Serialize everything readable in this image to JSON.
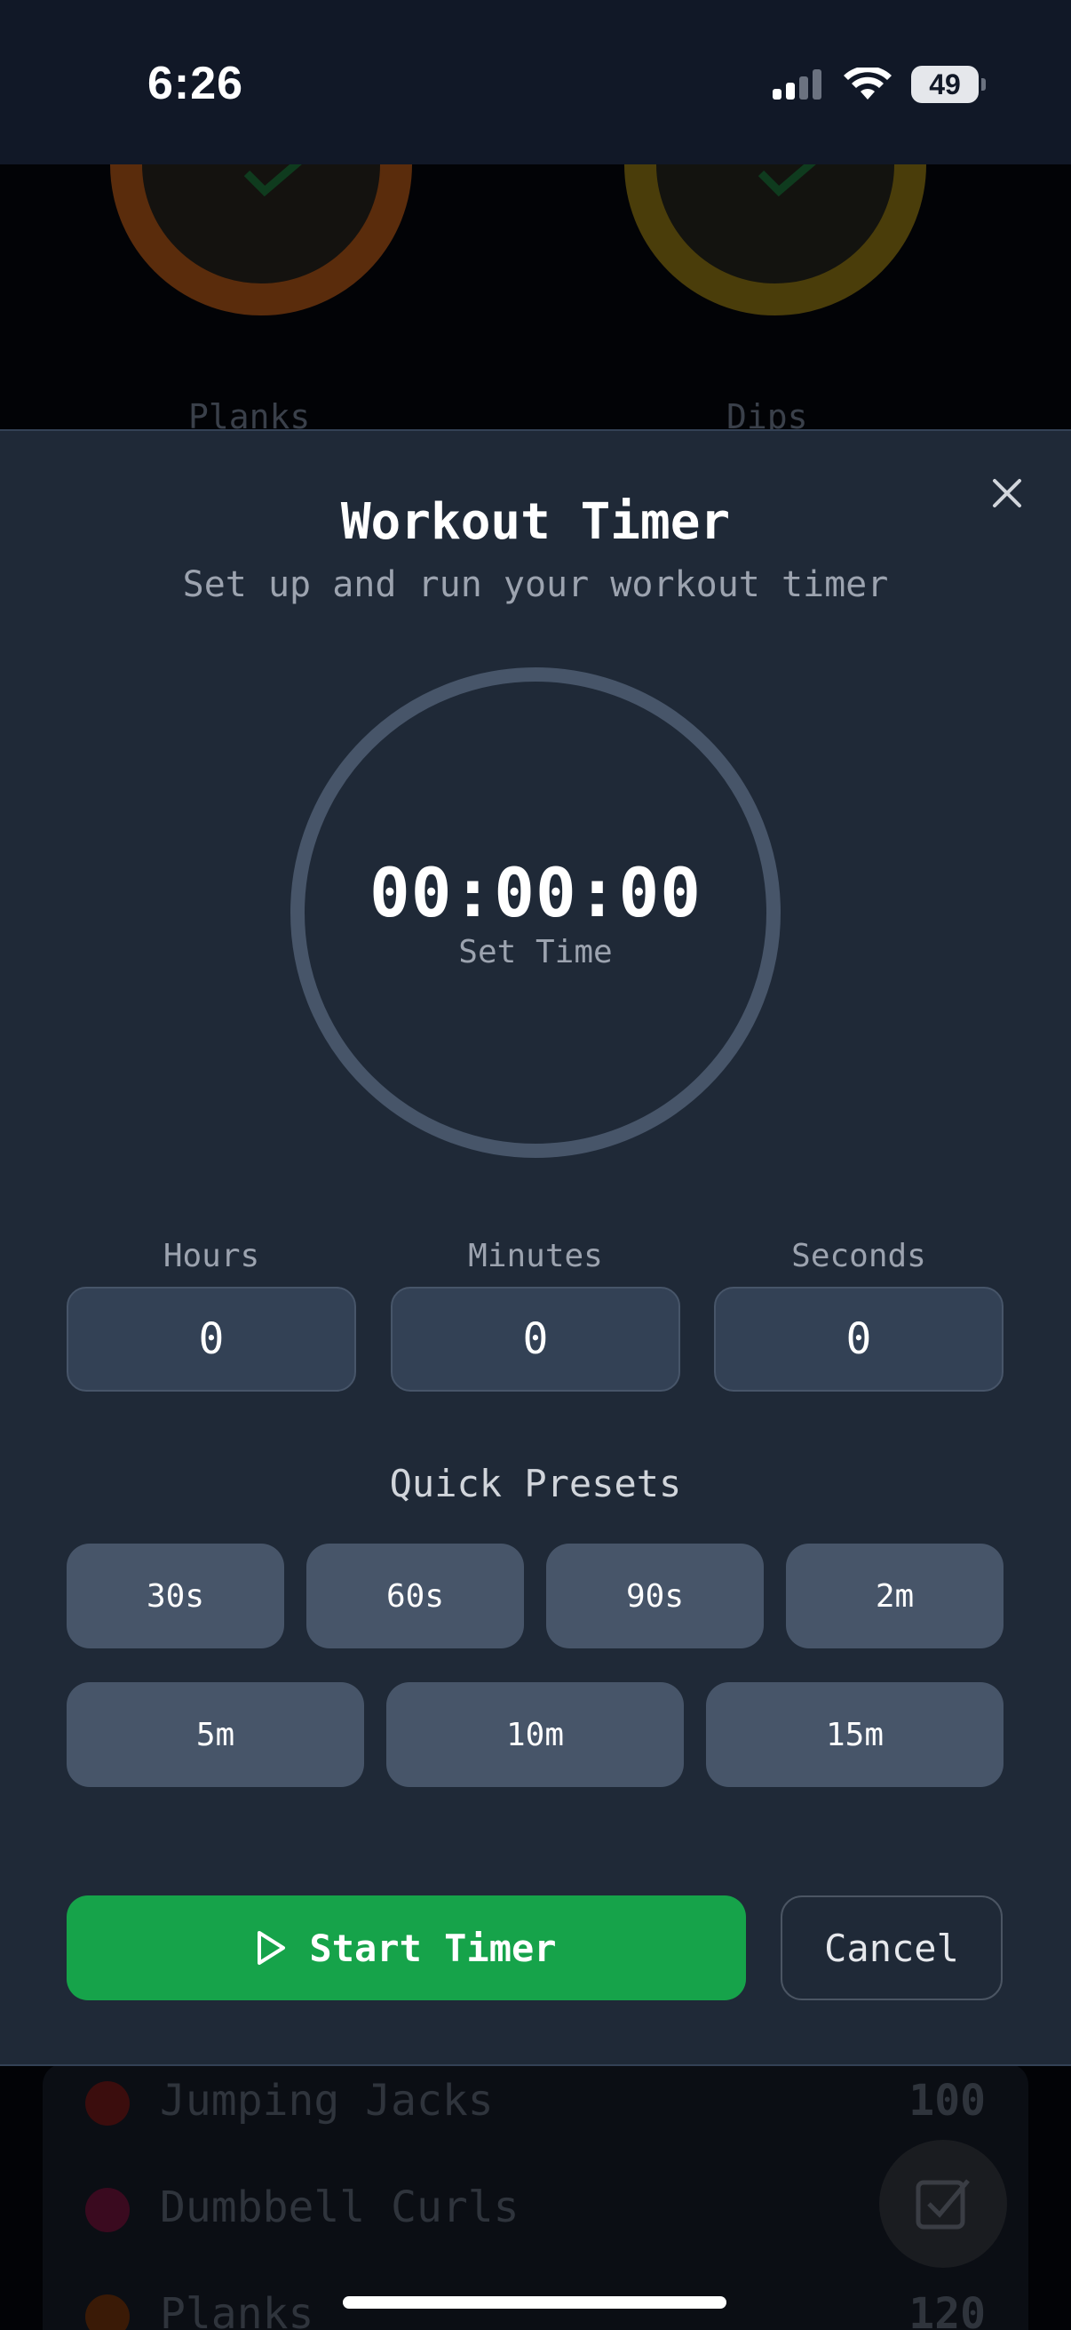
{
  "status_bar": {
    "time": "6:26",
    "battery": "49"
  },
  "background": {
    "top_labels": [
      "Planks",
      "Dips"
    ],
    "list": [
      {
        "name": "Jumping Jacks",
        "value": "100",
        "color": "#3b0d0d"
      },
      {
        "name": "Dumbbell Curls",
        "value": "",
        "color": "#3a0a1f"
      },
      {
        "name": "Planks",
        "value": "120",
        "color": "#3a1a06"
      }
    ]
  },
  "modal": {
    "title": "Workout Timer",
    "subtitle": "Set up and run your workout timer",
    "timer": {
      "display": "00:00:00",
      "status": "Set Time"
    },
    "fields": {
      "hours": {
        "label": "Hours",
        "value": "0"
      },
      "minutes": {
        "label": "Minutes",
        "value": "0"
      },
      "seconds": {
        "label": "Seconds",
        "value": "0"
      }
    },
    "presets_title": "Quick Presets",
    "presets": [
      "30s",
      "60s",
      "90s",
      "2m",
      "5m",
      "10m",
      "15m"
    ],
    "start_label": "Start Timer",
    "cancel_label": "Cancel"
  },
  "colors": {
    "accent_green": "#16a34a",
    "modal_bg": "#1f2937",
    "ring": "#475569"
  }
}
